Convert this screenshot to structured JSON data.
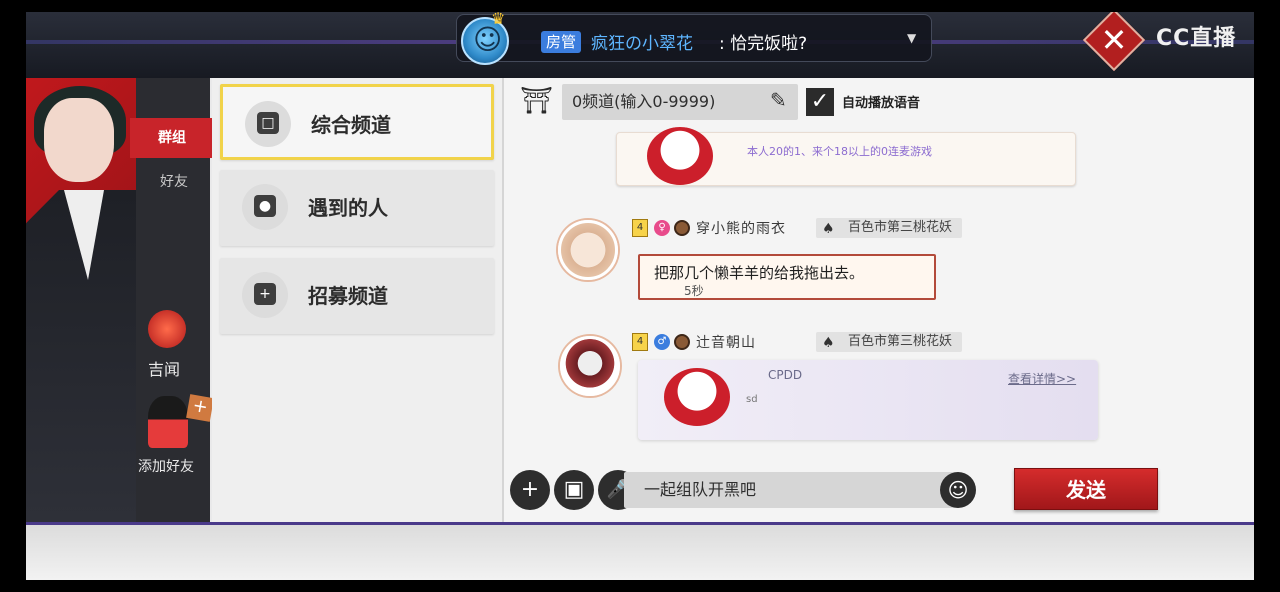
{
  "stream": {
    "role_badge": "房管",
    "user": "疯狂の小翠花",
    "message": ": 恰完饭啦?",
    "caret": "▼",
    "logo": "CC直播",
    "close": "✕"
  },
  "nav": {
    "items": [
      {
        "label": "群组",
        "active": true
      },
      {
        "label": "好友",
        "active": false
      }
    ],
    "lantern_label": "吉闻",
    "add_friend_label": "添加好友",
    "plus": "+"
  },
  "channels": [
    {
      "label": "综合频道",
      "icon": "□",
      "active": true
    },
    {
      "label": "遇到的人",
      "icon": "●",
      "active": false
    },
    {
      "label": "招募频道",
      "icon": "+",
      "active": false
    }
  ],
  "chat_header": {
    "torii_icon": "⛩",
    "channel_input_value": "0频道(输入0-9999)",
    "pen_icon": "✎",
    "auto_voice_checked": "✓",
    "auto_voice_label": "自动播放语音"
  },
  "messages": [
    {
      "top_text": "本人20的1、来个18以上的0连麦游戏"
    },
    {
      "level": "4",
      "gender": "♀",
      "name": "穿小熊的雨衣",
      "guild": "百色市第三桃花妖",
      "text": "把那几个懒羊羊的给我拖出去。",
      "duration": "5秒"
    },
    {
      "level": "4",
      "gender": "♂",
      "name": "辻音朝山",
      "guild": "百色市第三桃花妖",
      "card_title": "CPDD",
      "card_link": "查看详情>>",
      "card_sub": "sd"
    }
  ],
  "input_bar": {
    "plus_btn": "+",
    "photo_btn": "▣",
    "mic_btn": "🎤",
    "placeholder": "一起组队开黑吧",
    "emoji_btn": "☺",
    "send_label": "发送"
  },
  "colors": {
    "accent_red": "#c8242a",
    "active_border": "#f1d34a",
    "guild_bg": "#e2e2e2"
  }
}
